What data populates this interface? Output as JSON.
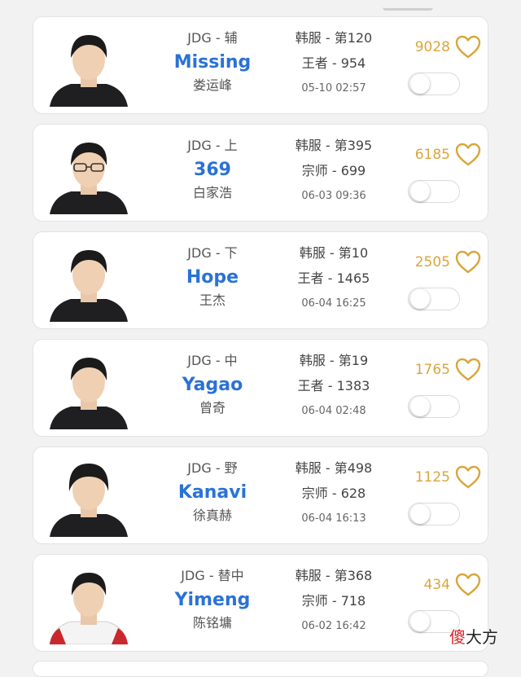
{
  "players": [
    {
      "team_role": "JDG - 辅",
      "nickname": "Missing",
      "real_name": "娄运峰",
      "server_rank": "韩服 - 第120",
      "tier_score": "王者 - 954",
      "update_time": "05-10 02:57",
      "likes": "9028",
      "toggled": false
    },
    {
      "team_role": "JDG - 上",
      "nickname": "369",
      "real_name": "白家浩",
      "server_rank": "韩服 - 第395",
      "tier_score": "宗师 - 699",
      "update_time": "06-03 09:36",
      "likes": "6185",
      "toggled": false
    },
    {
      "team_role": "JDG - 下",
      "nickname": "Hope",
      "real_name": "王杰",
      "server_rank": "韩服 - 第10",
      "tier_score": "王者 - 1465",
      "update_time": "06-04 16:25",
      "likes": "2505",
      "toggled": false
    },
    {
      "team_role": "JDG - 中",
      "nickname": "Yagao",
      "real_name": "曾奇",
      "server_rank": "韩服 - 第19",
      "tier_score": "王者 - 1383",
      "update_time": "06-04 02:48",
      "likes": "1765",
      "toggled": false
    },
    {
      "team_role": "JDG - 野",
      "nickname": "Kanavi",
      "real_name": "徐真赫",
      "server_rank": "韩服 - 第498",
      "tier_score": "宗师 - 628",
      "update_time": "06-04 16:13",
      "likes": "1125",
      "toggled": false
    },
    {
      "team_role": "JDG - 替中",
      "nickname": "Yimeng",
      "real_name": "陈铭墉",
      "server_rank": "韩服 - 第368",
      "tier_score": "宗师 - 718",
      "update_time": "06-02 16:42",
      "likes": "434",
      "toggled": false
    }
  ],
  "watermark": {
    "first": "傻",
    "rest": "大方"
  },
  "colors": {
    "nickname": "#2a72d6",
    "likes": "#d9a63b",
    "watermark_accent": "#d8262a"
  },
  "icons": {
    "like": "heart-outline-icon",
    "avatar": "player-portrait"
  }
}
